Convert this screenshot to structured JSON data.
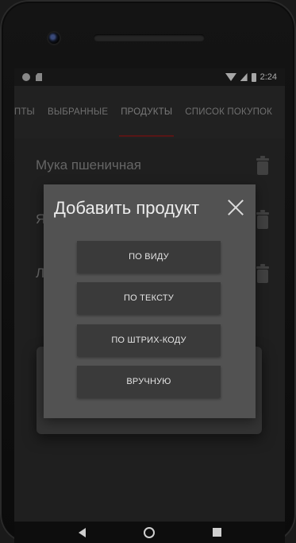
{
  "status_bar": {
    "time": "2:24"
  },
  "tabs": [
    {
      "label": "ЕПТЫ"
    },
    {
      "label": "ВЫБРАННЫЕ"
    },
    {
      "label": "ПРОДУКТЫ"
    },
    {
      "label": "СПИСОК ПОКУПОК"
    }
  ],
  "active_tab": "ПРОДУКТЫ",
  "list": [
    {
      "name": "Мука пшеничная"
    },
    {
      "name": "Я"
    },
    {
      "name": "Л"
    }
  ],
  "dialog": {
    "title": "Добавить продукт",
    "buttons": {
      "by_view": "ПО ВИДУ",
      "by_text": "ПО ТЕКСТУ",
      "by_barcode": "ПО ШТРИХ-КОДУ",
      "manual": "ВРУЧНУЮ"
    }
  },
  "colors": {
    "accent_underline": "#7a1f1f",
    "dialog_bg": "#525252",
    "button_bg": "#3a3a3a"
  }
}
